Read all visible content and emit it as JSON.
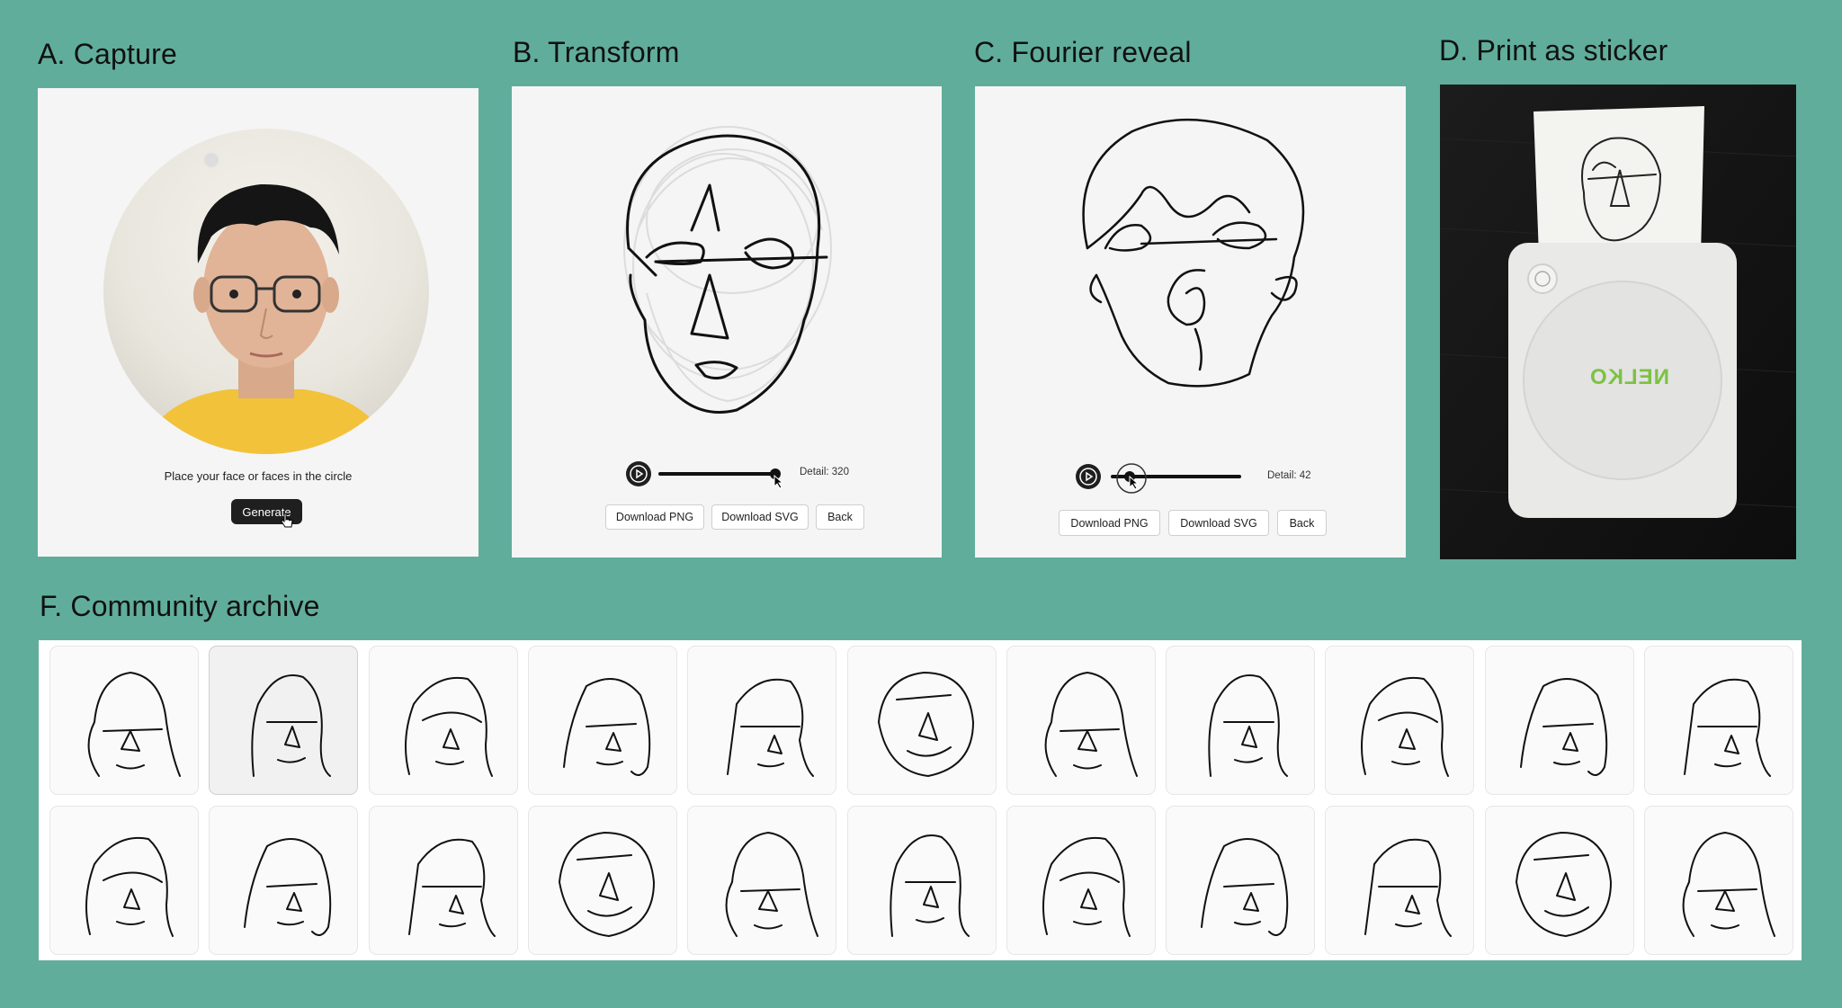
{
  "sections": {
    "capture": "A. Capture",
    "transform": "B. Transform",
    "fourier": "C. Fourier reveal",
    "print": "D. Print as sticker",
    "archive": "F. Community archive"
  },
  "capture_panel": {
    "hint": "Place your face or faces in the circle",
    "generate_label": "Generate"
  },
  "transform_panel": {
    "detail": "Detail: 320",
    "slider_value_fraction": 0.98,
    "buttons": [
      "Download PNG",
      "Download SVG",
      "Back"
    ]
  },
  "fourier_panel": {
    "detail": "Detail: 42",
    "slider_value_fraction": 0.15,
    "buttons": [
      "Download PNG",
      "Download SVG",
      "Back"
    ]
  },
  "print_panel": {
    "printer_brand": "NELKO"
  },
  "archive": {
    "rows": 2,
    "columns": 11,
    "selected_index": 1
  },
  "colors": {
    "background": "#61ad9c",
    "panel": "#f5f5f5",
    "brand_green": "#7cc242"
  }
}
